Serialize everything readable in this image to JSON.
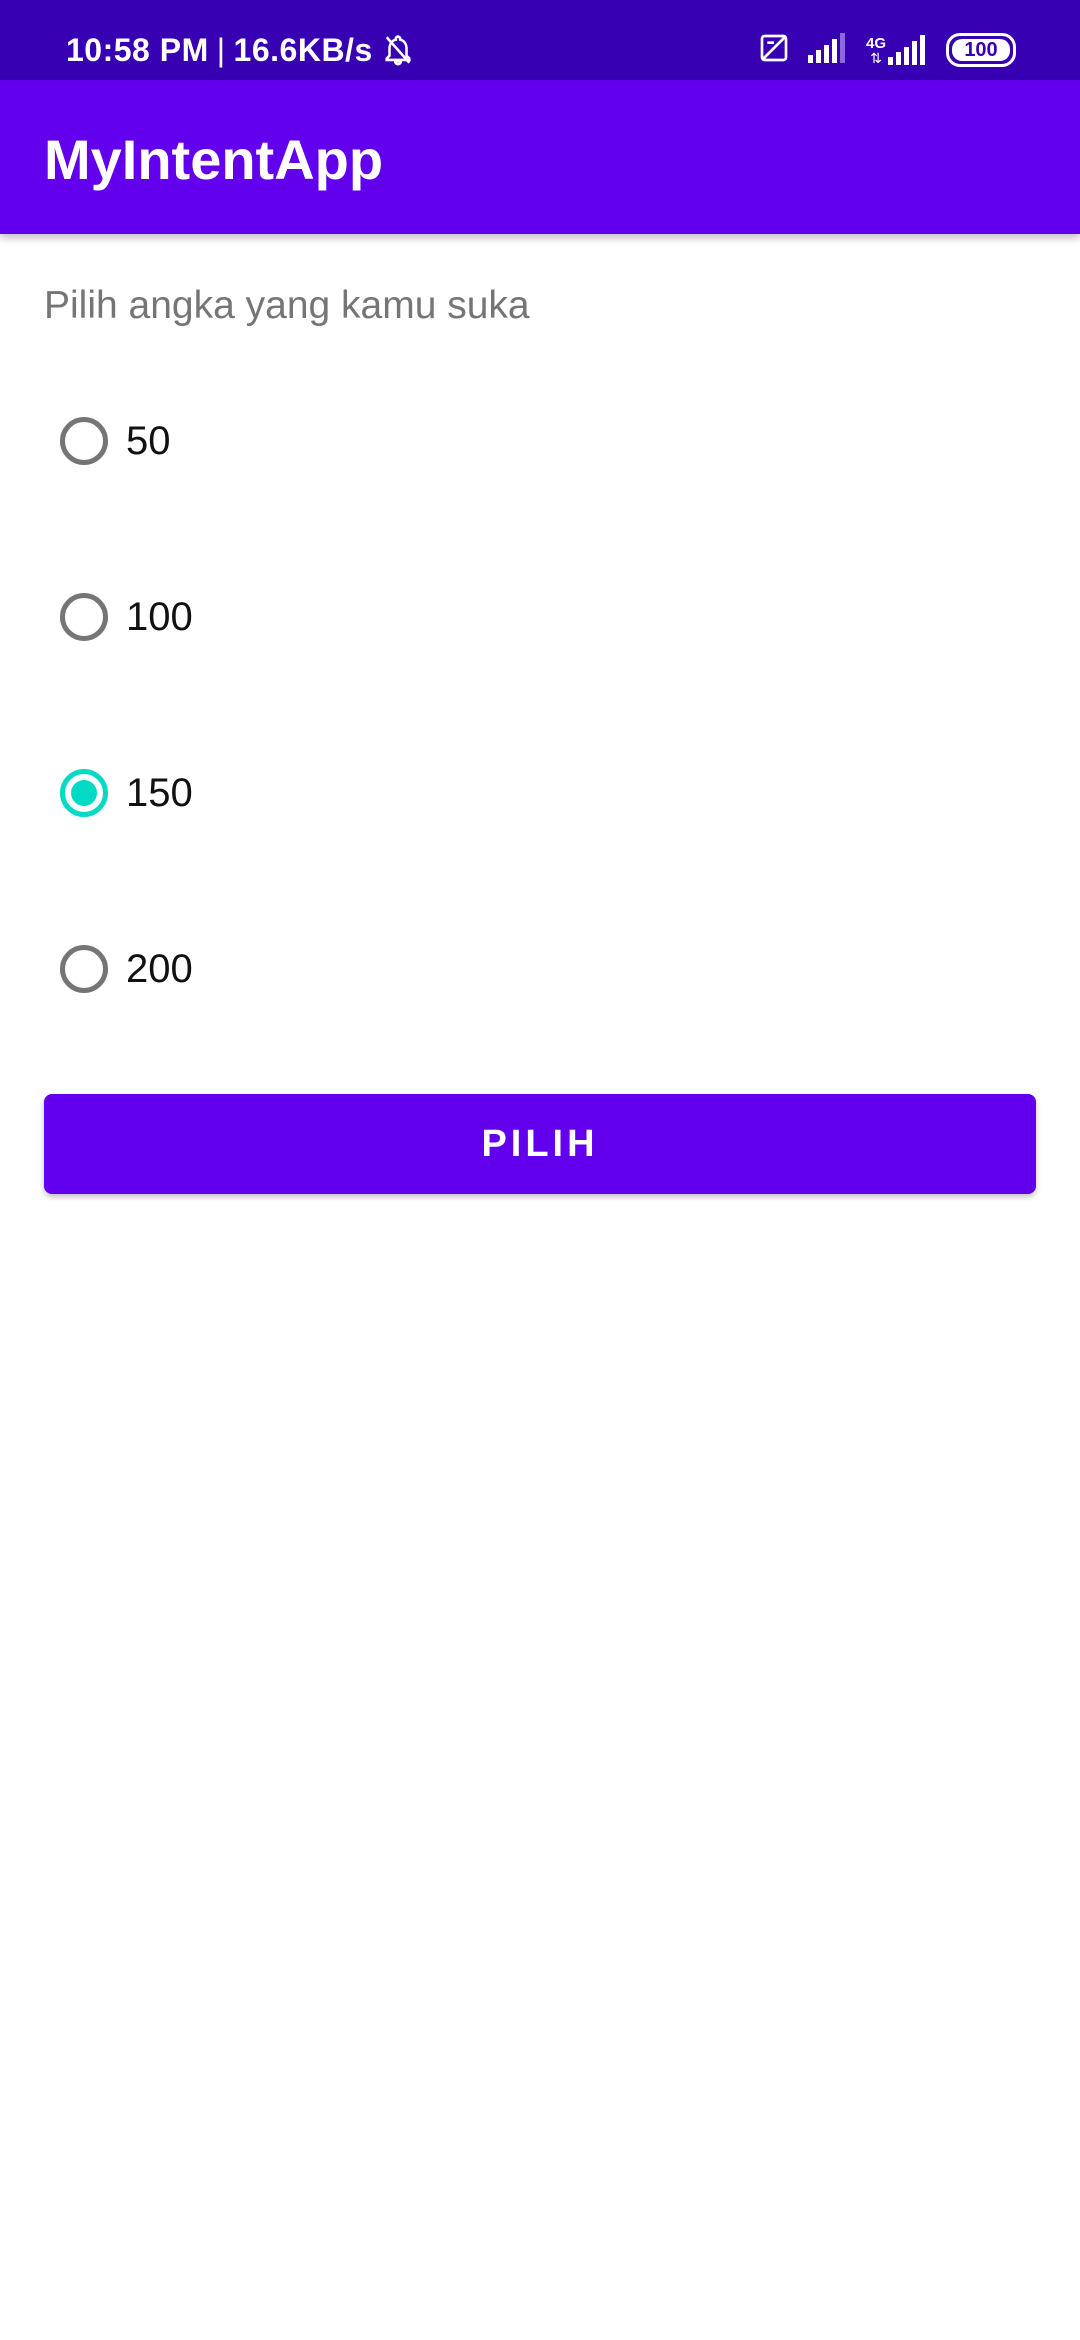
{
  "status_bar": {
    "time": "10:58 PM",
    "separator": "|",
    "net_speed": "16.6KB/s",
    "network_label": "4G",
    "battery": "100",
    "icons": [
      "bell-off-icon",
      "no-sim-icon",
      "signal-icon",
      "signal-4g-icon",
      "battery-icon"
    ]
  },
  "app_bar": {
    "title": "MyIntentApp"
  },
  "prompt": "Pilih angka yang kamu suka",
  "options": [
    {
      "label": "50",
      "checked": false
    },
    {
      "label": "100",
      "checked": false
    },
    {
      "label": "150",
      "checked": true
    },
    {
      "label": "200",
      "checked": false
    }
  ],
  "button": {
    "label": "PILIH"
  },
  "colors": {
    "status_bar": "#3700b3",
    "primary": "#6200ee",
    "accent": "#03dac5",
    "radio_unchecked": "#757575",
    "prompt_text": "#757575"
  }
}
